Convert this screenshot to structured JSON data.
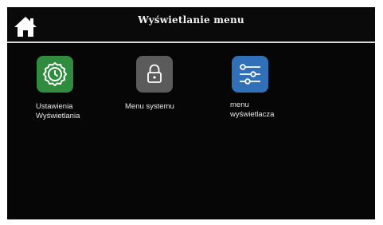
{
  "header": {
    "title": "Wyświetlanie menu",
    "home_icon": "home-icon"
  },
  "tiles": [
    {
      "id": "display-settings",
      "label": "Ustawienia\nWyświetlania",
      "icon": "clock-gear-icon",
      "color": "#2f8b3d"
    },
    {
      "id": "system-menu",
      "label": "Menu systemu",
      "icon": "lock-icon",
      "color": "#5b5b5b"
    },
    {
      "id": "display-menu",
      "label": "menu\nwyświetlacza",
      "icon": "sliders-icon",
      "color": "#2f70b8"
    }
  ]
}
